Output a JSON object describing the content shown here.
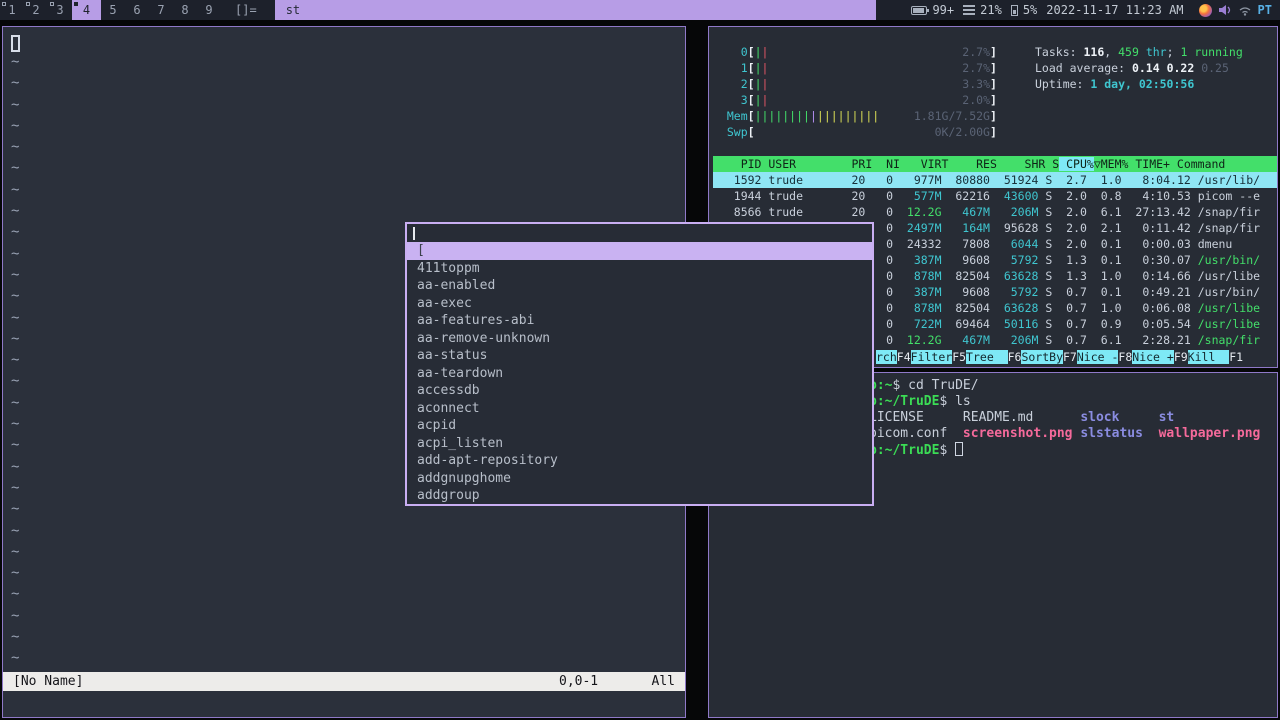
{
  "topbar": {
    "tags": [
      {
        "label": "1",
        "state": "occupied"
      },
      {
        "label": "2",
        "state": "occupied"
      },
      {
        "label": "3",
        "state": "occupied"
      },
      {
        "label": "4",
        "state": "selected"
      },
      {
        "label": "5",
        "state": "empty"
      },
      {
        "label": "6",
        "state": "empty"
      },
      {
        "label": "7",
        "state": "empty"
      },
      {
        "label": "8",
        "state": "empty"
      },
      {
        "label": "9",
        "state": "empty"
      }
    ],
    "layout_symbol": "[]=",
    "window_title": "st",
    "status": {
      "battery": "99+",
      "memory": "21%",
      "cpu": "5%",
      "datetime": "2022-11-17 11:23 AM",
      "keyboard_layout": "PT"
    },
    "tray_icons": [
      "firefox-icon",
      "volume-icon",
      "wifi-icon"
    ]
  },
  "vim": {
    "tilde_char": "~",
    "tilde_count": 29,
    "statusline": {
      "filename": "[No Name]",
      "cursor_position": "0,0-1",
      "scroll_position": "All"
    }
  },
  "dmenu": {
    "input_value": "",
    "selected_item": "[",
    "items": [
      "411toppm",
      "aa-enabled",
      "aa-exec",
      "aa-features-abi",
      "aa-remove-unknown",
      "aa-status",
      "aa-teardown",
      "accessdb",
      "aconnect",
      "acpid",
      "acpi_listen",
      "add-apt-repository",
      "addgnupghome",
      "addgroup"
    ]
  },
  "htop": {
    "cpu_meters": [
      {
        "label": "0",
        "percent": "2.7%",
        "bars": [
          {
            "count": 1,
            "class": "bar-g"
          },
          {
            "count": 1,
            "class": "bar-r"
          }
        ]
      },
      {
        "label": "1",
        "percent": "2.7%",
        "bars": [
          {
            "count": 1,
            "class": "bar-g"
          },
          {
            "count": 1,
            "class": "bar-r"
          }
        ]
      },
      {
        "label": "2",
        "percent": "3.3%",
        "bars": [
          {
            "count": 1,
            "class": "bar-g"
          },
          {
            "count": 1,
            "class": "bar-r"
          }
        ]
      },
      {
        "label": "3",
        "percent": "2.0%",
        "bars": [
          {
            "count": 1,
            "class": "bar-g"
          },
          {
            "count": 1,
            "class": "bar-r"
          }
        ]
      }
    ],
    "mem_meter": {
      "label": "Mem",
      "value": "1.81G/7.52G",
      "bars": [
        {
          "count": 8,
          "class": "bar-g"
        },
        {
          "count": 1,
          "class": "bar-m"
        },
        {
          "count": 9,
          "class": "bar-y"
        }
      ]
    },
    "swp_meter": {
      "label": "Swp",
      "value": "0K/2.00G",
      "bars": []
    },
    "tasks_line": [
      [
        "Tasks: ",
        "fg"
      ],
      [
        "116",
        "b"
      ],
      [
        ", ",
        "fg"
      ],
      [
        "459",
        "g"
      ],
      [
        " thr",
        "t"
      ],
      [
        "; ",
        "fg"
      ],
      [
        "1",
        "g"
      ],
      [
        " running",
        "g"
      ]
    ],
    "load_line": [
      [
        "Load average: ",
        "fg"
      ],
      [
        "0.14 ",
        "b"
      ],
      [
        "0.22 ",
        "b"
      ],
      [
        "0.25",
        "dim"
      ]
    ],
    "uptime_line": [
      [
        "Uptime: ",
        "fg"
      ],
      [
        "1 day, ",
        "tb"
      ],
      [
        "02:50:56",
        "tb"
      ]
    ],
    "columns": {
      "pid": "PID",
      "user": "USER",
      "pri": "PRI",
      "ni": "NI",
      "virt": "VIRT",
      "res": "RES",
      "shr": "SHR",
      "s": "S",
      "cpu": "CPU%",
      "sort_arrow": "▽",
      "mem": "MEM%",
      "time": "TIME+",
      "command": "Command"
    },
    "rows": [
      {
        "pid": "1592",
        "user": "trude",
        "pri": "20",
        "ni": "0",
        "virt": "977M",
        "res": "80880",
        "shr": "51924",
        "s": "S",
        "cpu": "2.7",
        "mem": "1.0",
        "time": "8:04.12",
        "cmd": "/usr/lib/",
        "selected": true
      },
      {
        "pid": "1944",
        "user": "trude",
        "pri": "20",
        "ni": "0",
        "virt": "577M",
        "res": "62216",
        "shr": "43600",
        "s": "S",
        "cpu": "2.0",
        "mem": "0.8",
        "time": "4:10.53",
        "cmd": "picom --e",
        "vc": "t",
        "sc": "t"
      },
      {
        "pid": "8566",
        "user": "trude",
        "pri": "20",
        "ni": "0",
        "virt": "12.2G",
        "res": "467M",
        "shr": "206M",
        "s": "S",
        "cpu": "2.0",
        "mem": "6.1",
        "time": "27:13.42",
        "cmd": "/snap/fir",
        "vc": "g",
        "rc": "t",
        "sc": "t"
      },
      {
        "pid": "",
        "user": "",
        "pri": "",
        "ni": "0",
        "virt": "2497M",
        "res": "164M",
        "shr": "95628",
        "s": "S",
        "cpu": "2.0",
        "mem": "2.1",
        "time": "0:11.42",
        "cmd": "/snap/fir",
        "vc": "t",
        "rc": "t"
      },
      {
        "pid": "",
        "user": "",
        "pri": "",
        "ni": "0",
        "virt": "24332",
        "res": "7808",
        "shr": "6044",
        "s": "S",
        "cpu": "2.0",
        "mem": "0.1",
        "time": "0:00.03",
        "cmd": "dmenu",
        "sc": "t"
      },
      {
        "pid": "",
        "user": "",
        "pri": "",
        "ni": "0",
        "virt": "387M",
        "res": "9608",
        "shr": "5792",
        "s": "S",
        "cpu": "1.3",
        "mem": "0.1",
        "time": "0:30.07",
        "cmd": "/usr/bin/",
        "vc": "t",
        "sc": "t",
        "cc": "g"
      },
      {
        "pid": "",
        "user": "",
        "pri": "",
        "ni": "0",
        "virt": "878M",
        "res": "82504",
        "shr": "63628",
        "s": "S",
        "cpu": "1.3",
        "mem": "1.0",
        "time": "0:14.66",
        "cmd": "/usr/libe",
        "vc": "t",
        "sc": "t"
      },
      {
        "pid": "",
        "user": "",
        "pri": "",
        "ni": "0",
        "virt": "387M",
        "res": "9608",
        "shr": "5792",
        "s": "S",
        "cpu": "0.7",
        "mem": "0.1",
        "time": "0:49.21",
        "cmd": "/usr/bin/",
        "vc": "t",
        "sc": "t"
      },
      {
        "pid": "",
        "user": "",
        "pri": "",
        "ni": "0",
        "virt": "878M",
        "res": "82504",
        "shr": "63628",
        "s": "S",
        "cpu": "0.7",
        "mem": "1.0",
        "time": "0:06.08",
        "cmd": "/usr/libe",
        "vc": "t",
        "sc": "t",
        "cc": "g"
      },
      {
        "pid": "",
        "user": "",
        "pri": "",
        "ni": "0",
        "virt": "722M",
        "res": "69464",
        "shr": "50116",
        "s": "S",
        "cpu": "0.7",
        "mem": "0.9",
        "time": "0:05.54",
        "cmd": "/usr/libe",
        "vc": "t",
        "sc": "t",
        "cc": "g"
      },
      {
        "pid": "",
        "user": "",
        "pri": "",
        "ni": "0",
        "virt": "12.2G",
        "res": "467M",
        "shr": "206M",
        "s": "S",
        "cpu": "0.7",
        "mem": "6.1",
        "time": "2:28.21",
        "cmd": "/snap/fir",
        "vc": "g",
        "rc": "t",
        "sc": "t",
        "cc": "g"
      }
    ],
    "fn_keys": [
      {
        "key": "",
        "label": "rch"
      },
      {
        "key": "F4",
        "label": "Filter"
      },
      {
        "key": "F5",
        "label": "Tree"
      },
      {
        "key": "F6",
        "label": "SortBy"
      },
      {
        "key": "F7",
        "label": "Nice -"
      },
      {
        "key": "F8",
        "label": "Nice +"
      },
      {
        "key": "F9",
        "label": "Kill"
      },
      {
        "key": "F1",
        "label": ""
      }
    ]
  },
  "terminal": {
    "lines": [
      [
        [
          "p:~",
          "gp"
        ],
        [
          "$ ",
          "fg"
        ],
        [
          "cd TruDE/",
          "fg"
        ]
      ],
      [
        [
          "p:~/TruDE",
          "gp"
        ],
        [
          "$ ",
          "fg"
        ],
        [
          "ls",
          "fg"
        ]
      ],
      [
        [
          "LICENSE     ",
          "fg"
        ],
        [
          "README.md      ",
          "fg"
        ],
        [
          "slock     ",
          "v"
        ],
        [
          "st",
          "v"
        ]
      ],
      [
        [
          "picom.conf  ",
          "fg"
        ],
        [
          "screenshot.png ",
          "p"
        ],
        [
          "slstatus  ",
          "v"
        ],
        [
          "wallpaper.png",
          "p"
        ]
      ],
      [
        [
          "p:~/TruDE",
          "gp"
        ],
        [
          "$ ",
          "fg"
        ],
        [
          "",
          "cursor"
        ]
      ]
    ]
  },
  "colors": {
    "accent_lavender": "#b79de6",
    "htop_header_green": "#43df6a",
    "selection_cyan": "#8fe6f4",
    "window_border_purple": "#8f79c8",
    "dmenu_border": "#c9aef2"
  }
}
